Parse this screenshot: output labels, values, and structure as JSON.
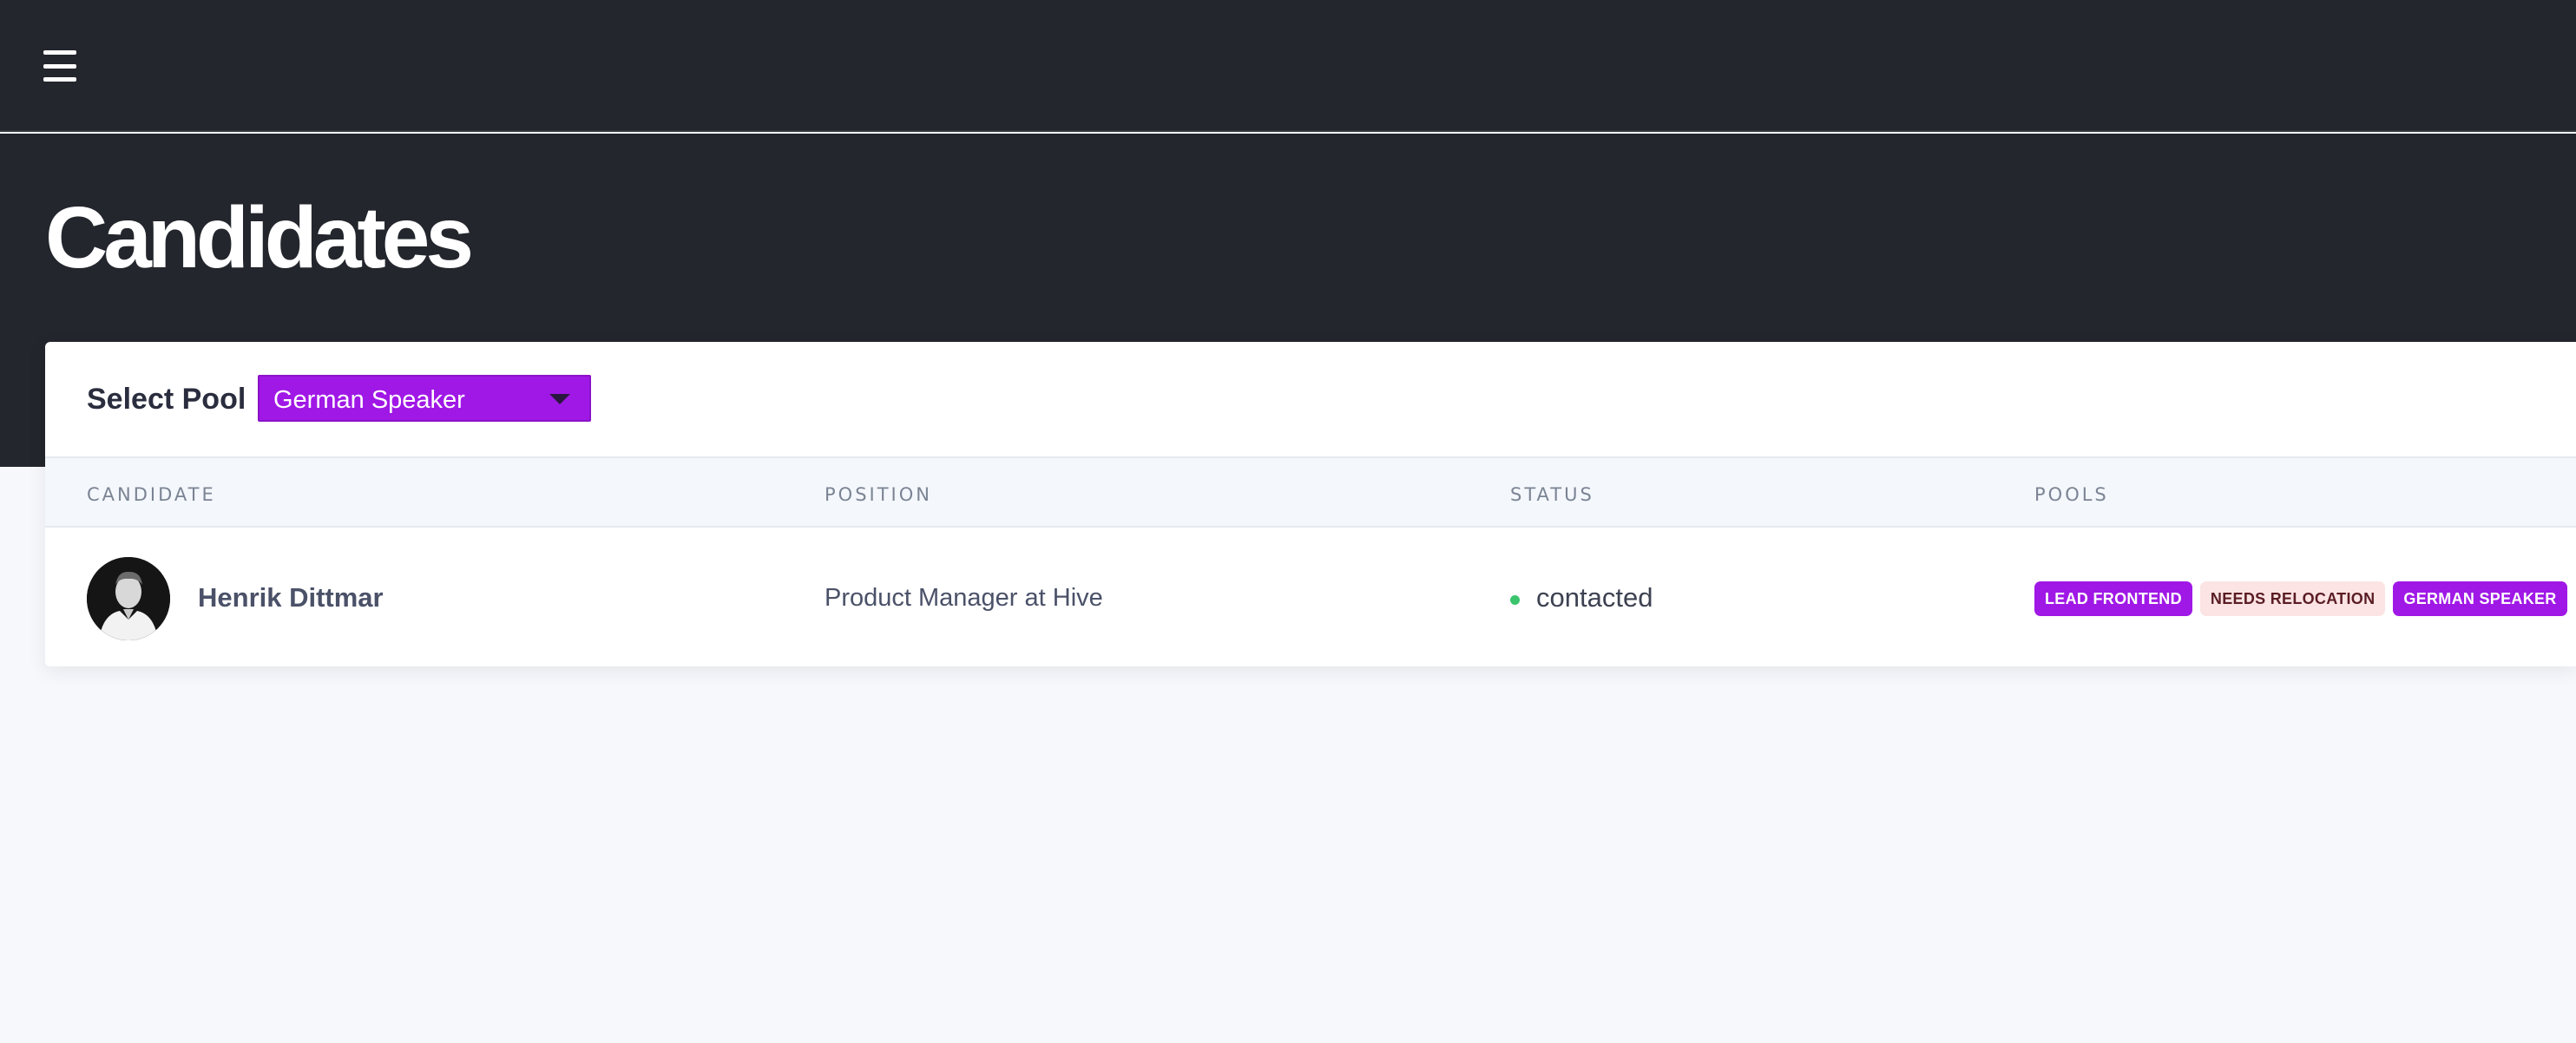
{
  "header": {
    "menu_icon": "hamburger-menu-icon"
  },
  "page": {
    "title": "Candidates"
  },
  "pool_selector": {
    "label": "Select Pool",
    "selected": "German Speaker",
    "arrow_icon": "caret-down-icon",
    "accent_color": "#a018e6"
  },
  "table": {
    "columns": [
      "CANDIDATE",
      "POSITION",
      "STATUS",
      "POOLS"
    ],
    "rows": [
      {
        "name": "Henrik Dittmar",
        "position": "Product Manager at Hive",
        "status": "contacted",
        "status_color": "#3ac46d",
        "pools": [
          {
            "label": "LEAD FRONTEND",
            "color": "#a018e6"
          },
          {
            "label": "NEEDS RELOCATION",
            "color": "#fce4e4"
          },
          {
            "label": "GERMAN SPEAKER",
            "color": "#a018e6"
          }
        ]
      }
    ]
  }
}
